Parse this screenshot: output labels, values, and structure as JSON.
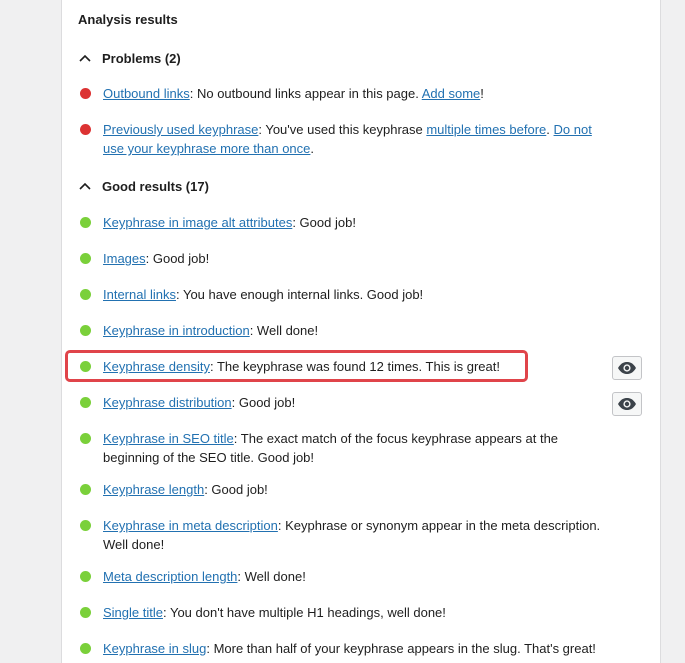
{
  "panel_title": "Analysis results",
  "problems": {
    "heading": "Problems (2)",
    "items": [
      {
        "link": "Outbound links",
        "text1": ": No outbound links appear in this page. ",
        "link2": "Add some",
        "text2": "!"
      },
      {
        "link": "Previously used keyphrase",
        "text1": ": You've used this keyphrase ",
        "link2": "multiple times before",
        "text2": ". ",
        "link3": "Do not use your keyphrase more than once",
        "text3": "."
      }
    ]
  },
  "good": {
    "heading": "Good results (17)",
    "items": [
      {
        "link": "Keyphrase in image alt attributes",
        "text": ": Good job!"
      },
      {
        "link": "Images",
        "text": ": Good job!"
      },
      {
        "link": "Internal links",
        "text": ": You have enough internal links. Good job!"
      },
      {
        "link": "Keyphrase in introduction",
        "text": ": Well done!"
      },
      {
        "link": "Keyphrase density",
        "text": ": The keyphrase was found 12 times. This is great!"
      },
      {
        "link": "Keyphrase distribution",
        "text": ": Good job!"
      },
      {
        "link": "Keyphrase in SEO title",
        "text": ": The exact match of the focus keyphrase appears at the beginning of the SEO title. Good job!"
      },
      {
        "link": "Keyphrase length",
        "text": ": Good job!"
      },
      {
        "link": "Keyphrase in meta description",
        "text": ": Keyphrase or synonym appear in the meta description. Well done!"
      },
      {
        "link": "Meta description length",
        "text": ": Well done!"
      },
      {
        "link": "Single title",
        "text": ": You don't have multiple H1 headings, well done!"
      },
      {
        "link": "Keyphrase in slug",
        "text": ": More than half of your keyphrase appears in the slug. That's great!"
      }
    ]
  },
  "icons": {
    "collapse": "chevron-up-icon",
    "eye": "eye-icon",
    "bullet_bad": "red-dot",
    "bullet_good": "green-dot"
  },
  "colors": {
    "bad": "#dc3232",
    "good": "#7ad03a",
    "link": "#2271b1",
    "highlight": "#e0444a"
  }
}
